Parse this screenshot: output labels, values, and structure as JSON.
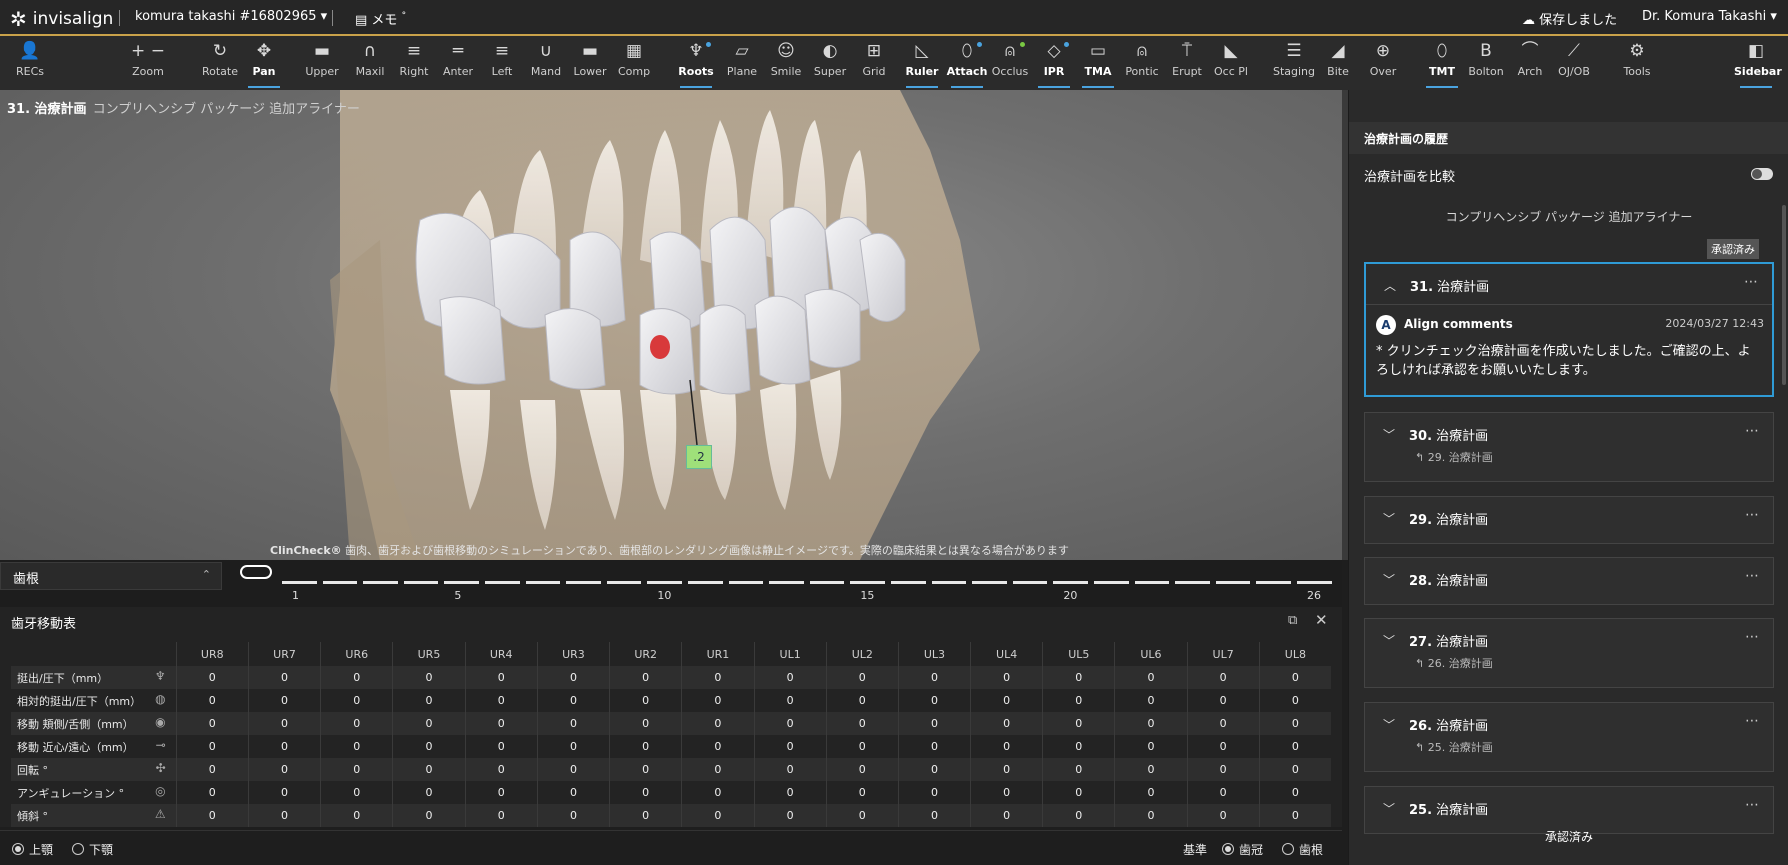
{
  "topbar": {
    "brand": "invisalign",
    "patient": "komura takashi #16802965",
    "memo": "メモ",
    "save_status": "保存しました",
    "doctor": "Dr. Komura Takashi"
  },
  "toolbar": [
    {
      "label": "RECs",
      "icon": "person-icon",
      "glyph": "👤"
    },
    {
      "label": "Zoom",
      "icon": "zoom-icon",
      "glyph": "+ −"
    },
    {
      "label": "Rotate",
      "icon": "rotate-icon",
      "glyph": "↻"
    },
    {
      "label": "Pan",
      "icon": "pan-icon",
      "glyph": "✥",
      "active": true
    },
    {
      "label": "Upper",
      "icon": "upper-icon",
      "glyph": "▬"
    },
    {
      "label": "Maxil",
      "icon": "maxil-icon",
      "glyph": "∩"
    },
    {
      "label": "Right",
      "icon": "right-icon",
      "glyph": "≡"
    },
    {
      "label": "Anter",
      "icon": "anter-icon",
      "glyph": "═"
    },
    {
      "label": "Left",
      "icon": "left-icon",
      "glyph": "≡"
    },
    {
      "label": "Mand",
      "icon": "mand-icon",
      "glyph": "∪"
    },
    {
      "label": "Lower",
      "icon": "lower-icon",
      "glyph": "▬"
    },
    {
      "label": "Comp",
      "icon": "comp-icon",
      "glyph": "▦"
    },
    {
      "label": "Roots",
      "icon": "roots-icon",
      "glyph": "♆",
      "active": true,
      "dot": "#4aa3df"
    },
    {
      "label": "Plane",
      "icon": "plane-icon",
      "glyph": "▱"
    },
    {
      "label": "Smile",
      "icon": "smile-icon",
      "glyph": "☺"
    },
    {
      "label": "Super",
      "icon": "super-icon",
      "glyph": "◐"
    },
    {
      "label": "Grid",
      "icon": "grid-icon",
      "glyph": "⊞"
    },
    {
      "label": "Ruler",
      "icon": "ruler-icon",
      "glyph": "◺",
      "active": true
    },
    {
      "label": "Attach",
      "icon": "attach-icon",
      "glyph": "⬯",
      "active": true,
      "dot": "#4aa3df"
    },
    {
      "label": "Occlus",
      "icon": "occlus-icon",
      "glyph": "⍝",
      "dot": "#7ac943"
    },
    {
      "label": "IPR",
      "icon": "ipr-icon",
      "glyph": "◇",
      "active": true,
      "dot": "#4aa3df"
    },
    {
      "label": "TMA",
      "icon": "tma-icon",
      "glyph": "▭",
      "active": true
    },
    {
      "label": "Pontic",
      "icon": "pontic-icon",
      "glyph": "⍝"
    },
    {
      "label": "Erupt",
      "icon": "erupt-icon",
      "glyph": "⍑"
    },
    {
      "label": "Occ Pl",
      "icon": "occ-pl-icon",
      "glyph": "◣"
    },
    {
      "label": "Staging",
      "icon": "staging-icon",
      "glyph": "☰"
    },
    {
      "label": "Bite",
      "icon": "bite-icon",
      "glyph": "◢"
    },
    {
      "label": "Over",
      "icon": "over-icon",
      "glyph": "⊕"
    },
    {
      "label": "TMT",
      "icon": "tmt-icon",
      "glyph": "⬯",
      "active": true
    },
    {
      "label": "Bolton",
      "icon": "bolton-icon",
      "glyph": "B"
    },
    {
      "label": "Arch",
      "icon": "arch-icon",
      "glyph": "⌒"
    },
    {
      "label": "OJ/OB",
      "icon": "ojob-icon",
      "glyph": "⟋"
    },
    {
      "label": "Tools",
      "icon": "tools-icon",
      "glyph": "⚙"
    },
    {
      "label": "Sidebar",
      "icon": "sidebar-icon",
      "glyph": "◧",
      "active": true
    }
  ],
  "viewport": {
    "plan_number": "31. 治療計画",
    "plan_subtitle": "コンプリヘンシブ パッケージ 追加アライナー",
    "ipr_tag": ".2",
    "disclaimer_brand": "ClinCheck®",
    "disclaimer": "歯肉、歯牙および歯根移動のシミュレーションであり、歯根部のレンダリング画像は静止イメージです。実際の臨床結果とは異なる場合があります"
  },
  "roots_dropdown": "歯根",
  "timeline": {
    "ticks": [
      "1",
      "5",
      "10",
      "15",
      "20",
      "26"
    ]
  },
  "movement_table": {
    "title": "歯牙移動表",
    "columns": [
      "UR8",
      "UR7",
      "UR6",
      "UR5",
      "UR4",
      "UR3",
      "UR2",
      "UR1",
      "UL1",
      "UL2",
      "UL3",
      "UL4",
      "UL5",
      "UL6",
      "UL7",
      "UL8"
    ],
    "rows": [
      {
        "label": "挺出/圧下（mm）",
        "values": [
          "0",
          "0",
          "0",
          "0",
          "0",
          "0",
          "0",
          "0",
          "0",
          "0",
          "0",
          "0",
          "0",
          "0",
          "0",
          "0"
        ]
      },
      {
        "label": "相対的挺出/圧下（mm）",
        "values": [
          "0",
          "0",
          "0",
          "0",
          "0",
          "0",
          "0",
          "0",
          "0",
          "0",
          "0",
          "0",
          "0",
          "0",
          "0",
          "0"
        ]
      },
      {
        "label": "移動 頬側/舌側（mm）",
        "values": [
          "0",
          "0",
          "0",
          "0",
          "0",
          "0",
          "0",
          "0",
          "0",
          "0",
          "0",
          "0",
          "0",
          "0",
          "0",
          "0"
        ]
      },
      {
        "label": "移動 近心/遠心（mm）",
        "values": [
          "0",
          "0",
          "0",
          "0",
          "0",
          "0",
          "0",
          "0",
          "0",
          "0",
          "0",
          "0",
          "0",
          "0",
          "0",
          "0"
        ]
      },
      {
        "label": "回転 °",
        "values": [
          "0",
          "0",
          "0",
          "0",
          "0",
          "0",
          "0",
          "0",
          "0",
          "0",
          "0",
          "0",
          "0",
          "0",
          "0",
          "0"
        ]
      },
      {
        "label": "アンギュレーション °",
        "values": [
          "0",
          "0",
          "0",
          "0",
          "0",
          "0",
          "0",
          "0",
          "0",
          "0",
          "0",
          "0",
          "0",
          "0",
          "0",
          "0"
        ]
      },
      {
        "label": "傾斜 °",
        "values": [
          "0",
          "0",
          "0",
          "0",
          "0",
          "0",
          "0",
          "0",
          "0",
          "0",
          "0",
          "0",
          "0",
          "0",
          "0",
          "0"
        ]
      }
    ]
  },
  "bottombar": {
    "upper": "上顎",
    "lower": "下顎",
    "reference": "基準",
    "crown": "歯冠",
    "root": "歯根"
  },
  "sidebar": {
    "header": "治療計画の履歴",
    "compare": "治療計画を比較",
    "package": "コンプリヘンシブ パッケージ 追加アライナー",
    "approved_badge": "承認済み",
    "active_card": {
      "title_num": "31.",
      "title": "治療計画",
      "author_initial": "A",
      "author": "Align comments",
      "date": "2024/03/27 12:43",
      "message": "* クリンチェック治療計画を作成いたしました。ご確認の上、よろしければ承認をお願いいたします。"
    },
    "cards": [
      {
        "num": "30.",
        "title": "治療計画",
        "sub": "29. 治療計画"
      },
      {
        "num": "29.",
        "title": "治療計画"
      },
      {
        "num": "28.",
        "title": "治療計画"
      },
      {
        "num": "27.",
        "title": "治療計画",
        "sub": "26. 治療計画"
      },
      {
        "num": "26.",
        "title": "治療計画",
        "sub": "25. 治療計画"
      },
      {
        "num": "25.",
        "title": "治療計画"
      }
    ],
    "footer": "承認済み"
  }
}
